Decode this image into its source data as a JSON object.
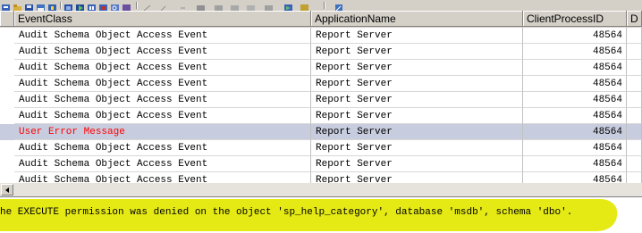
{
  "grid": {
    "columns": [
      "EventClass",
      "ApplicationName",
      "ClientProcessID",
      "D"
    ],
    "rows": [
      {
        "event": "Audit Schema Object Access Event",
        "app": "Report Server",
        "pid": "48564",
        "selected": false
      },
      {
        "event": "Audit Schema Object Access Event",
        "app": "Report Server",
        "pid": "48564",
        "selected": false
      },
      {
        "event": "Audit Schema Object Access Event",
        "app": "Report Server",
        "pid": "48564",
        "selected": false
      },
      {
        "event": "Audit Schema Object Access Event",
        "app": "Report Server",
        "pid": "48564",
        "selected": false
      },
      {
        "event": "Audit Schema Object Access Event",
        "app": "Report Server",
        "pid": "48564",
        "selected": false
      },
      {
        "event": "Audit Schema Object Access Event",
        "app": "Report Server",
        "pid": "48564",
        "selected": false
      },
      {
        "event": "User Error Message",
        "app": "Report Server",
        "pid": "48564",
        "selected": true,
        "error": true
      },
      {
        "event": "Audit Schema Object Access Event",
        "app": "Report Server",
        "pid": "48564",
        "selected": false
      },
      {
        "event": "Audit Schema Object Access Event",
        "app": "Report Server",
        "pid": "48564",
        "selected": false
      },
      {
        "event": "Audit Schema Object Access Event",
        "app": "Report Server",
        "pid": "48564",
        "selected": false
      }
    ]
  },
  "detail": {
    "message": "he EXECUTE permission was denied on the object 'sp_help_category', database 'msdb', schema 'dbo'."
  },
  "colors": {
    "selected_row": "#c7ccde",
    "error_text": "#ff0000",
    "highlight": "#e3e800"
  },
  "toolbar": {
    "icons": [
      "new-trace-icon",
      "open-icon",
      "save-icon",
      "properties-icon",
      "template-icon",
      "clear-icon",
      "run-icon",
      "pause-icon",
      "stop-icon",
      "find-icon",
      "window-icon",
      "layout-icon",
      "columns-icon",
      "filter-icon",
      "bookmark-icon"
    ]
  }
}
